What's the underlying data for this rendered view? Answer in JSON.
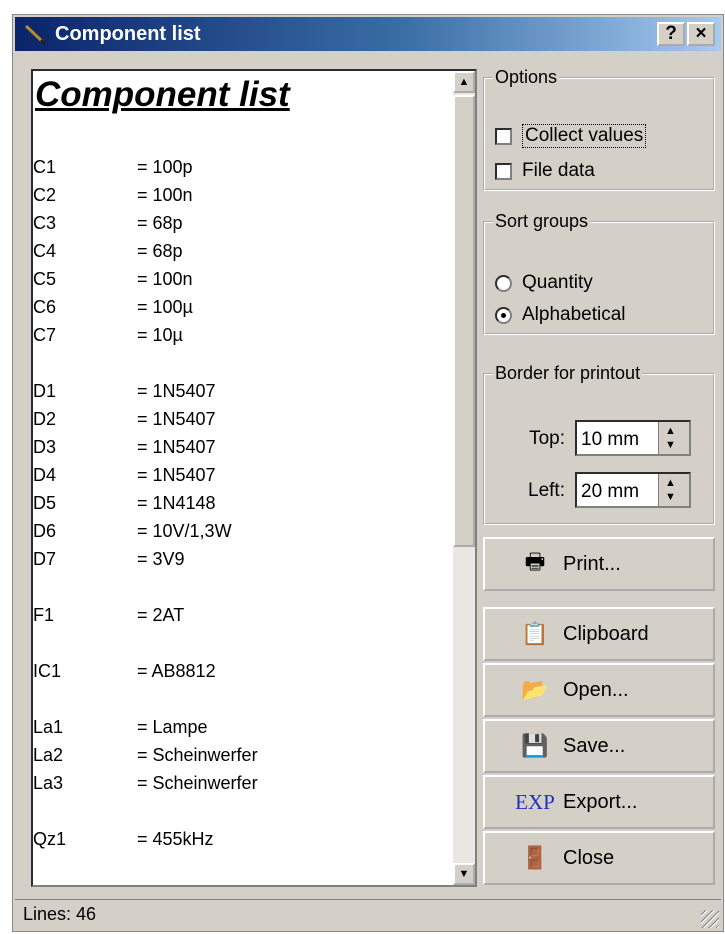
{
  "window": {
    "title": "Component list"
  },
  "titlebar_buttons": {
    "help": "?",
    "close": "×"
  },
  "list": {
    "heading": "Component list",
    "rows": [
      {
        "ref": "C1",
        "val": "= 100p"
      },
      {
        "ref": "C2",
        "val": "= 100n"
      },
      {
        "ref": "C3",
        "val": "= 68p"
      },
      {
        "ref": "C4",
        "val": "= 68p"
      },
      {
        "ref": "C5",
        "val": "= 100n"
      },
      {
        "ref": "C6",
        "val": "= 100µ"
      },
      {
        "ref": "C7",
        "val": "= 10µ"
      },
      {
        "ref": "D1",
        "val": "= 1N5407"
      },
      {
        "ref": "D2",
        "val": "= 1N5407"
      },
      {
        "ref": "D3",
        "val": "= 1N5407"
      },
      {
        "ref": "D4",
        "val": "= 1N5407"
      },
      {
        "ref": "D5",
        "val": "= 1N4148"
      },
      {
        "ref": "D6",
        "val": "= 10V/1,3W"
      },
      {
        "ref": "D7",
        "val": "= 3V9"
      },
      {
        "ref": "F1",
        "val": "= 2AT"
      },
      {
        "ref": "IC1",
        "val": "= AB8812"
      },
      {
        "ref": "La1",
        "val": "= Lampe"
      },
      {
        "ref": "La2",
        "val": "= Scheinwerfer"
      },
      {
        "ref": "La3",
        "val": "= Scheinwerfer"
      },
      {
        "ref": "Qz1",
        "val": "= 455kHz"
      }
    ]
  },
  "options": {
    "legend": "Options",
    "collect_values": "Collect values",
    "file_data": "File data",
    "collect_values_checked": false,
    "file_data_checked": false
  },
  "sort_groups": {
    "legend": "Sort groups",
    "quantity": "Quantity",
    "alphabetical": "Alphabetical",
    "selected": "Alphabetical"
  },
  "border": {
    "legend": "Border for printout",
    "top_label": "Top:",
    "top_value": "10 mm",
    "left_label": "Left:",
    "left_value": "20 mm"
  },
  "buttons": {
    "print": "Print...",
    "clipboard": "Clipboard",
    "open": "Open...",
    "save": "Save...",
    "export": "Export...",
    "close": "Close"
  },
  "status": {
    "lines": "Lines: 46"
  },
  "icons": {
    "app": "pen-icon",
    "print": "printer-icon",
    "clipboard": "clipboard-icon",
    "open": "folder-open-icon",
    "save": "floppy-disk-icon",
    "export": "exp-icon",
    "close": "door-exit-icon"
  },
  "colors": {
    "title_start": "#0a246a",
    "title_end": "#a6caf0",
    "face": "#d4d0c8"
  }
}
